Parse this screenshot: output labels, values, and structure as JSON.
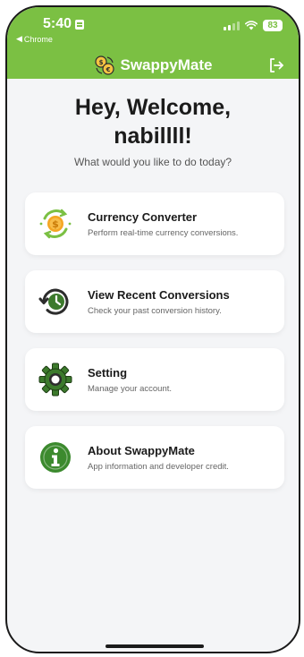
{
  "status_bar": {
    "time": "5:40",
    "back_app": "Chrome",
    "battery": "83"
  },
  "app_bar": {
    "title": "SwappyMate",
    "icons": {
      "logo": "swap-coins-icon",
      "logout": "logout-icon"
    }
  },
  "greeting": {
    "line1": "Hey, Welcome,",
    "line2": "nabillll!",
    "subtitle": "What would you like to do today?"
  },
  "menu": [
    {
      "title": "Currency Converter",
      "desc": "Perform real-time currency conversions.",
      "icon": "currency-exchange-icon"
    },
    {
      "title": "View Recent Conversions",
      "desc": "Check your past conversion history.",
      "icon": "history-clock-icon"
    },
    {
      "title": "Setting",
      "desc": "Manage your account.",
      "icon": "gear-icon"
    },
    {
      "title": "About SwappyMate",
      "desc": "App information and developer credit.",
      "icon": "info-icon"
    }
  ],
  "colors": {
    "primary": "#7bc043",
    "icon_dark_green": "#3c7a2c",
    "coin_orange": "#f5a623",
    "background": "#f4f5f7"
  }
}
